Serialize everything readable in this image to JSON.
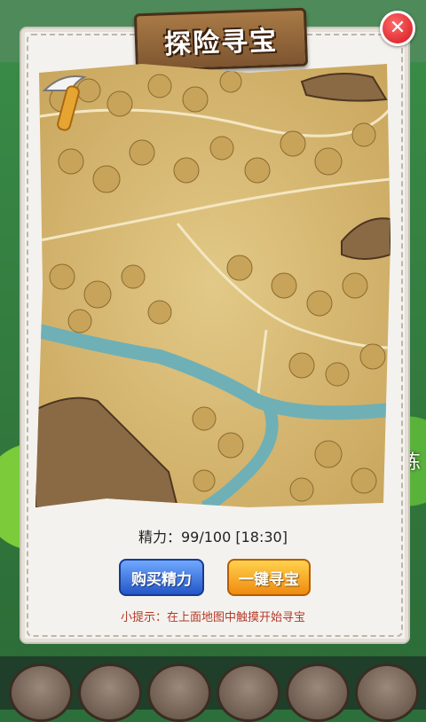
{
  "dialog": {
    "title": "探险寻宝",
    "close_icon": "close-icon"
  },
  "energy": {
    "label": "精力：",
    "current": 99,
    "max": 100,
    "text": "精力：99/100 [18:30]"
  },
  "buttons": {
    "buy_energy": "购买精力",
    "one_click_search": "一键寻宝"
  },
  "hint": "小提示：在上面地图中触摸开始寻宝",
  "background": {
    "side_label": "炼"
  },
  "colors": {
    "buy_button": "#2456c8",
    "search_button": "#f08a10",
    "close_button": "#d3161c",
    "hint_text": "#b33a2a",
    "map": "#d4b46c"
  }
}
